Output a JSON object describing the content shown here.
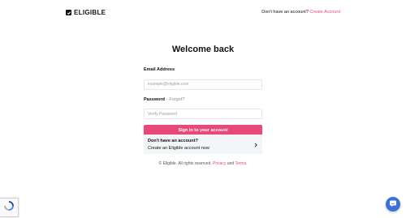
{
  "header": {
    "logo_text": "ELIGIBLE",
    "no_account_text": "Don't have an account?",
    "create_account_link": "Create Account"
  },
  "main": {
    "title": "Welcome back",
    "email": {
      "label": "Email Address",
      "placeholder": "example@eligible.com",
      "value": ""
    },
    "password": {
      "label": "Password",
      "forgot_link": "- Forgot?",
      "placeholder": "Verify Password",
      "value": ""
    },
    "submit_label": "Sign in to your account"
  },
  "signup_card": {
    "title": "Don't have an account?",
    "subtitle": "Create an Eligible account now"
  },
  "footer": {
    "prefix": "© Eligible. All rights reserved.",
    "privacy": "Privacy",
    "and": "and",
    "terms": "Terms",
    "period": "."
  },
  "colors": {
    "accent": "#e8497a",
    "chat": "#3f6fd8",
    "card_bg": "#f3f5f7"
  },
  "icons": {
    "logo": "check-box-icon",
    "card": "chevron-right-icon",
    "recaptcha": "recaptcha-icon",
    "chat": "chat-icon"
  }
}
